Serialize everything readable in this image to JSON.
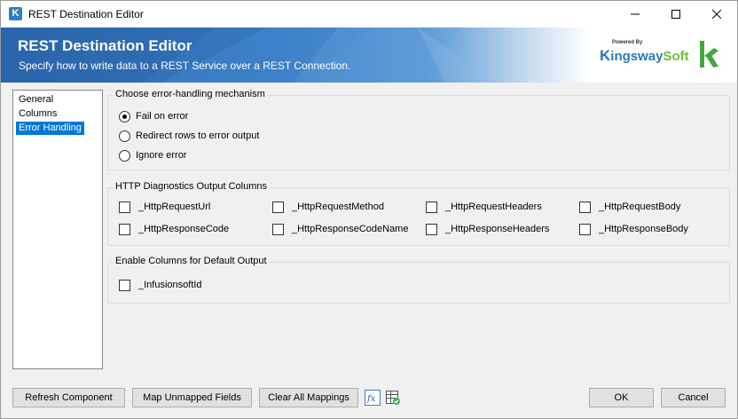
{
  "window": {
    "title": "REST Destination Editor"
  },
  "banner": {
    "title": "REST Destination Editor",
    "subtitle": "Specify how to write data to a REST Service over a REST Connection.",
    "logo_powered": "Powered By",
    "logo_k": "K",
    "logo_ingsway": "ingsway",
    "logo_soft": "Soft"
  },
  "nav": {
    "items": [
      {
        "label": "General"
      },
      {
        "label": "Columns"
      },
      {
        "label": "Error Handling"
      }
    ]
  },
  "error_handling": {
    "title": "Choose error-handling mechanism",
    "options": [
      {
        "label": "Fail on error",
        "checked": true
      },
      {
        "label": "Redirect rows to error output",
        "checked": false
      },
      {
        "label": "Ignore error",
        "checked": false
      }
    ]
  },
  "http_diag": {
    "title": "HTTP Diagnostics Output Columns",
    "columns": [
      "_HttpRequestUrl",
      "_HttpRequestMethod",
      "_HttpRequestHeaders",
      "_HttpRequestBody",
      "_HttpResponseCode",
      "_HttpResponseCodeName",
      "_HttpResponseHeaders",
      "_HttpResponseBody"
    ]
  },
  "default_output": {
    "title": "Enable Columns for Default Output",
    "columns": [
      "_InfusionsoftId"
    ]
  },
  "buttons": {
    "refresh": "Refresh Component",
    "map_unmapped": "Map Unmapped Fields",
    "clear_all": "Clear All Mappings",
    "ok": "OK",
    "cancel": "Cancel"
  },
  "colors": {
    "accent": "#0078d7",
    "banner_blue": "#2c6ab0",
    "brand_green": "#6cbf3c"
  }
}
